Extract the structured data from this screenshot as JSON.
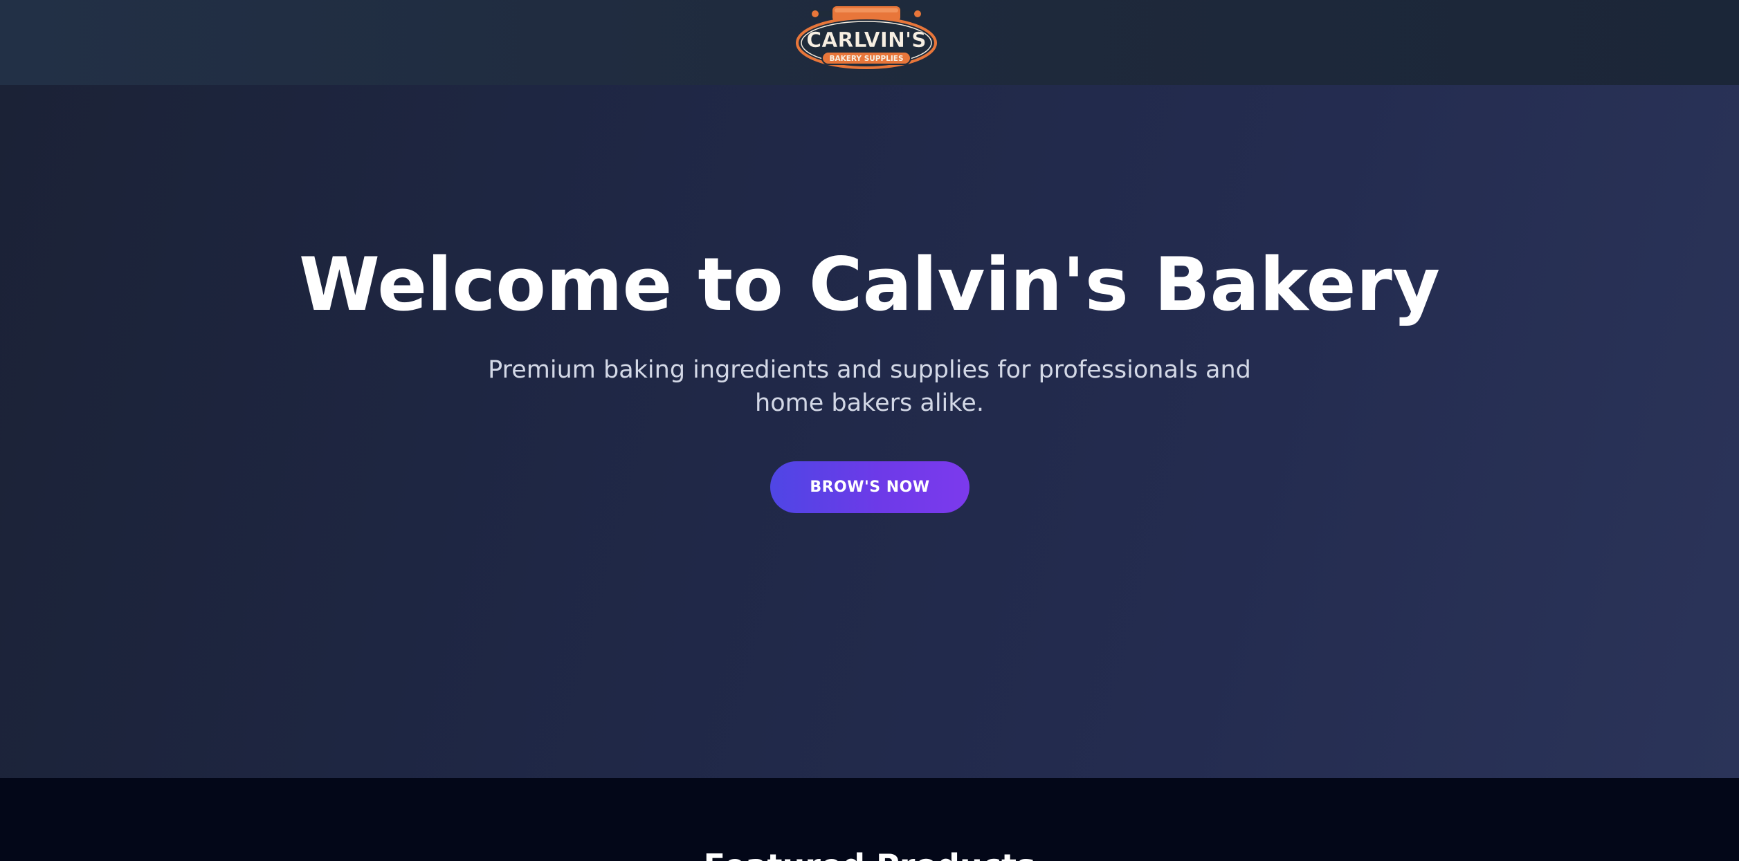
{
  "header": {
    "logo": {
      "name": "CARLVIN'S",
      "tagline": "BAKERY SUPPLIES",
      "icon": "rolling-pin-icon",
      "colors": {
        "primary": "#e8763a",
        "dark": "#1f2b3a",
        "cream": "#f7efe2"
      }
    }
  },
  "hero": {
    "title": "Welcome to Calvin's Bakery",
    "subtitle": "Premium baking ingredients and supplies for professionals and home bakers alike.",
    "cta_label": "BROW'S NOW"
  },
  "featured": {
    "title": "Featured Products"
  },
  "colors": {
    "header_bg": "#1e293b",
    "hero_bg": "#242c50",
    "cta_start": "#4f46e5",
    "cta_end": "#7c3aed",
    "section_bg": "#030718"
  }
}
